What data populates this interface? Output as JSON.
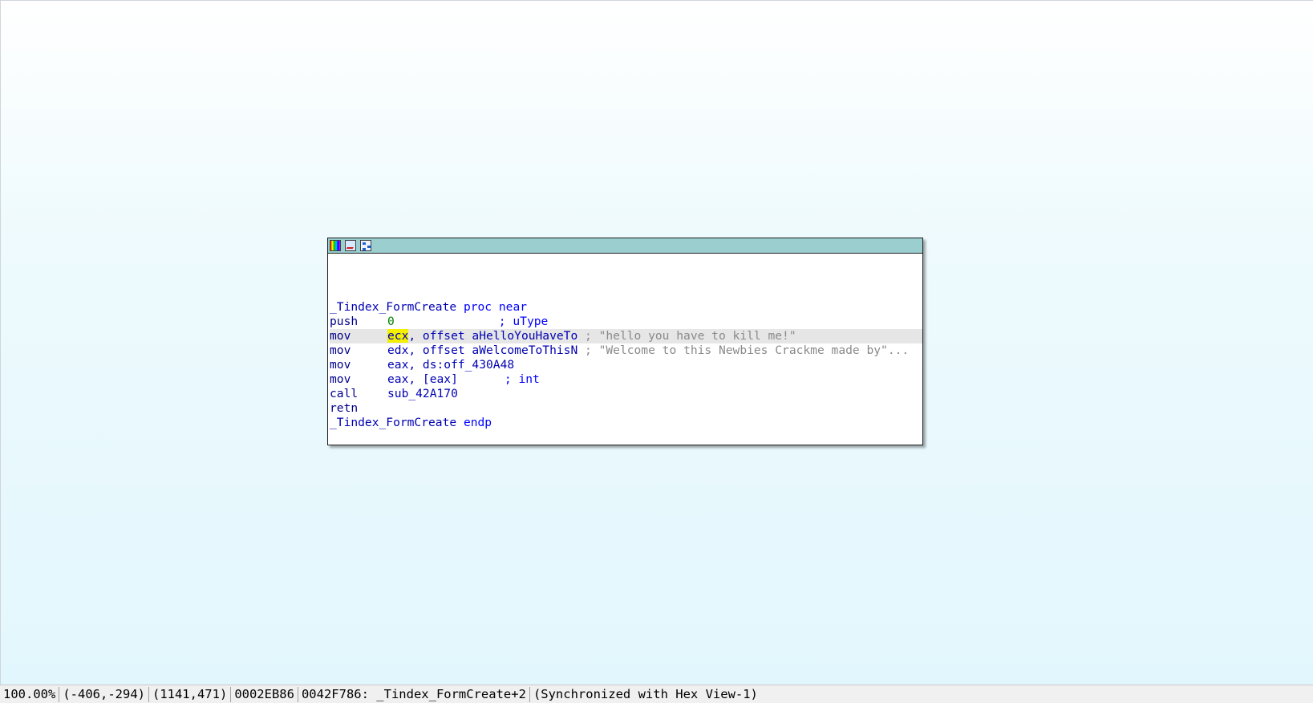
{
  "graph_node": {
    "title_icons": [
      "color-palette-icon",
      "edit-node-icon",
      "graph-overview-icon"
    ],
    "lines": [
      {
        "kind": "label",
        "name": "_Tindex_FormCreate",
        "suffix": " proc near"
      },
      {
        "kind": "instr",
        "mnemonic": "push",
        "operand": "0",
        "comment": "; uType"
      },
      {
        "kind": "instr",
        "mnemonic": "mov",
        "reg": "ecx",
        "operand_rest": ", offset aHelloYouHaveTo",
        "comment": " ; \"hello you have to kill me!\""
      },
      {
        "kind": "instr",
        "mnemonic": "mov",
        "reg": "edx",
        "operand_rest": ", offset aWelcomeToThisN",
        "comment": " ; \"Welcome to this Newbies Crackme made by\"..."
      },
      {
        "kind": "instr",
        "mnemonic": "mov",
        "operand": "eax, ds:off_430A48"
      },
      {
        "kind": "instr",
        "mnemonic": "mov",
        "operand": "eax, [eax]",
        "comment": "; int"
      },
      {
        "kind": "instr",
        "mnemonic": "call",
        "operand": "sub_42A170"
      },
      {
        "kind": "instr",
        "mnemonic": "retn"
      },
      {
        "kind": "label",
        "name": "_Tindex_FormCreate",
        "suffix": " endp"
      }
    ]
  },
  "status_bar": {
    "zoom": "100.00%",
    "graph_coords": "(-406,-294)",
    "mouse_coords": "(1141,471)",
    "file_offset": "0002EB86",
    "location": "0042F786: _Tindex_FormCreate+2",
    "sync": "(Synchronized with Hex View-1)"
  },
  "colors": {
    "title_bar": "#9bcfcf",
    "canvas_bottom": "#e2f7fd",
    "highlight": "#f4f000",
    "current_line": "#e6e6e6"
  }
}
